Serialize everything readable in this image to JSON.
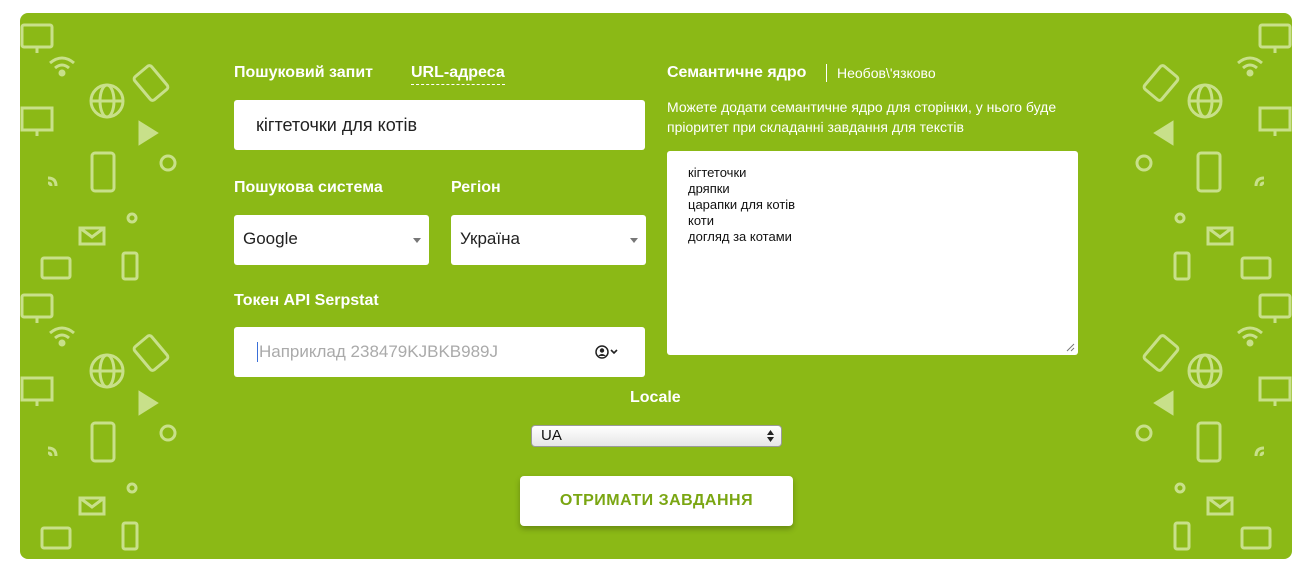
{
  "form": {
    "tab_query": "Пошуковий запит",
    "tab_url": "URL-адреса",
    "query_value": "кігтеточки для котів",
    "engine_label": "Пошукова система",
    "engine_value": "Google",
    "region_label": "Регіон",
    "region_value": "Україна",
    "token_label": "Токен API Serpstat",
    "token_placeholder": "Наприклад 238479KJBKB989J",
    "token_icon": "user-circle-icon"
  },
  "semantic": {
    "title": "Семантичне ядро",
    "optional": "Необов\\'язково",
    "hint": "Можете додати семантичне ядро для сторінки, у нього буде пріоритет при складанні завдання для текстів",
    "lines": [
      "кігтеточки",
      "дряпки",
      "царапки для котів",
      "коти",
      "догляд за котами"
    ]
  },
  "locale": {
    "label": "Locale",
    "value": "UA"
  },
  "submit_label": "ОТРИМАТИ ЗАВДАННЯ",
  "colors": {
    "panel": "#8bb916",
    "button_text": "#7aa612",
    "pattern": "#c8e08a"
  }
}
